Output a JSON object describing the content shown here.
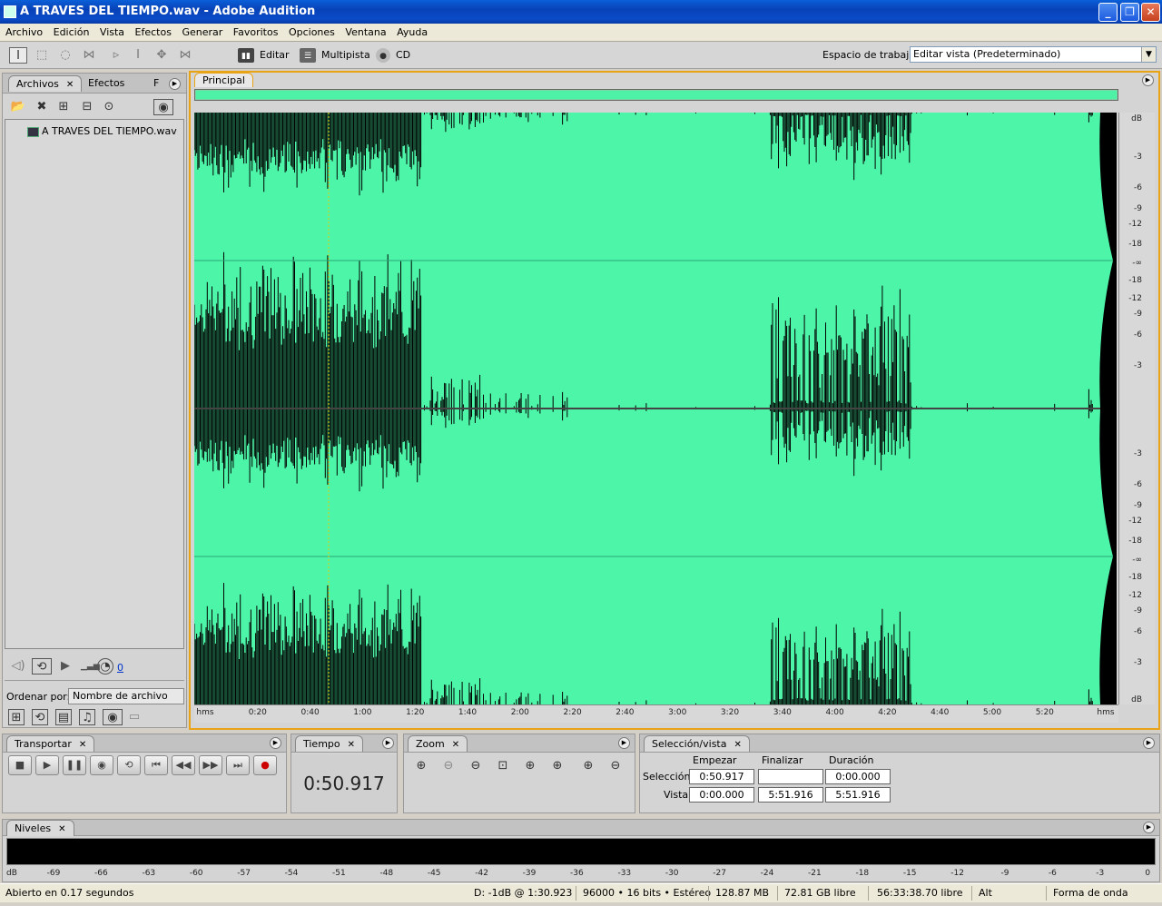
{
  "window": {
    "title": "A TRAVES DEL TIEMPO.wav - Adobe Audition"
  },
  "menu": [
    "Archivo",
    "Edición",
    "Vista",
    "Efectos",
    "Generar",
    "Favoritos",
    "Opciones",
    "Ventana",
    "Ayuda"
  ],
  "toolbar": {
    "modes": {
      "edit": "Editar",
      "multitrack": "Multipista",
      "cd": "CD"
    },
    "workspace_label": "Espacio de trabajo",
    "workspace_value": "Editar vista (Predeterminado)"
  },
  "left_panel": {
    "tabs": {
      "files": "Archivos",
      "effects": "Efectos",
      "third": "F"
    },
    "file_name": "A TRAVES DEL TIEMPO.wav",
    "volume_value": "0",
    "sort_label": "Ordenar por:",
    "sort_value": "Nombre de archivo"
  },
  "main_panel": {
    "tab": "Principal",
    "ruler_labels": [
      "hms",
      "0:20",
      "0:40",
      "1:00",
      "1:20",
      "1:40",
      "2:00",
      "2:20",
      "2:40",
      "3:00",
      "3:20",
      "3:40",
      "4:00",
      "4:20",
      "4:40",
      "5:00",
      "5:20",
      "hms"
    ],
    "db_labels": [
      "dB",
      "-3",
      "-6",
      "-9",
      "-12",
      "-18",
      "-∞",
      "-18",
      "-12",
      "-9",
      "-6",
      "-3",
      "",
      "-3",
      "-6",
      "-9",
      "-12",
      "-18",
      "-∞",
      "-18",
      "-12",
      "-9",
      "-6",
      "-3",
      "dB"
    ]
  },
  "transport": {
    "title": "Transportar"
  },
  "time": {
    "title": "Tiempo",
    "value": "0:50.917"
  },
  "zoom": {
    "title": "Zoom"
  },
  "selection": {
    "title": "Selección/vista",
    "col_start": "Empezar",
    "col_end": "Finalizar",
    "col_duration": "Duración",
    "row_selection": "Selección",
    "row_view": "Vista",
    "sel_start": "0:50.917",
    "sel_end": "",
    "sel_duration": "0:00.000",
    "view_start": "0:00.000",
    "view_end": "5:51.916",
    "view_duration": "5:51.916"
  },
  "levels": {
    "title": "Niveles",
    "scale": [
      "dB",
      "-69",
      "-66",
      "-63",
      "-60",
      "-57",
      "-54",
      "-51",
      "-48",
      "-45",
      "-42",
      "-39",
      "-36",
      "-33",
      "-30",
      "-27",
      "-24",
      "-21",
      "-18",
      "-15",
      "-12",
      "-9",
      "-6",
      "-3",
      "0"
    ]
  },
  "status": {
    "opened": "Abierto en 0.17 segundos",
    "cursor": "D: -1dB @   1:30.923",
    "format": "96000 • 16 bits • Estéreo",
    "size": "128.87 MB",
    "free": "72.81 GB libre",
    "time_free": "56:33:38.70 libre",
    "mode": "Alt",
    "view": "Forma de onda"
  },
  "colors": {
    "waveform_bg": "#4df5a8",
    "waveform_fg": "#000000",
    "accent": "#e8a317"
  }
}
